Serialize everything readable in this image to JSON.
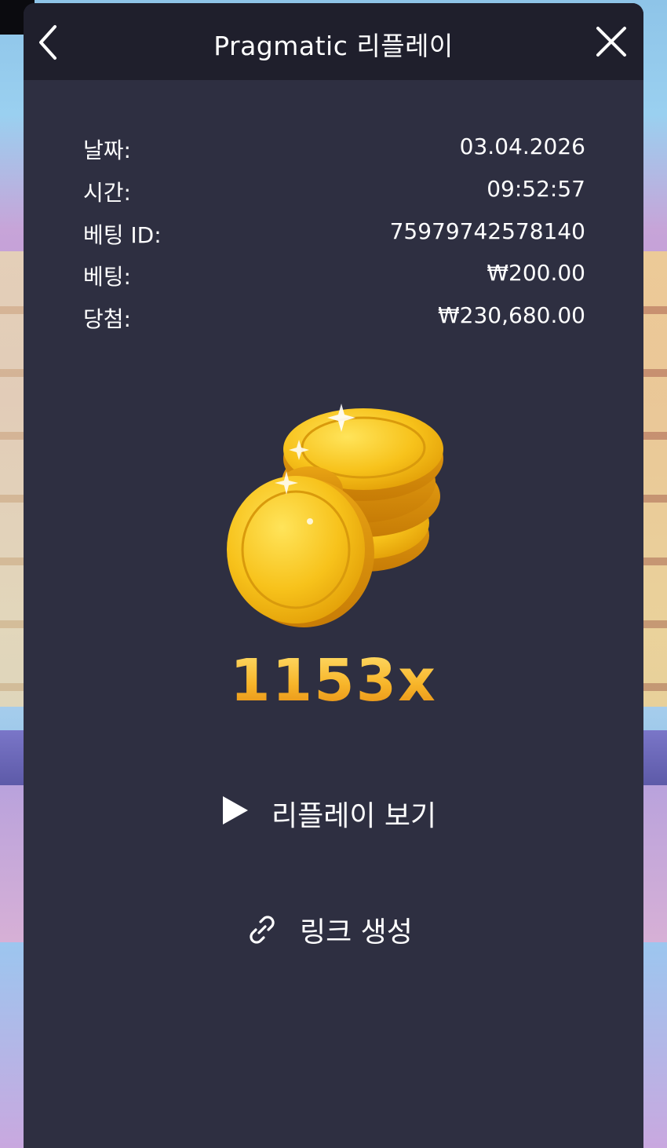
{
  "header": {
    "title": "Pragmatic 리플레이",
    "back_icon": "chevron-left-icon",
    "close_icon": "close-icon"
  },
  "details": [
    {
      "label": "날짜:",
      "value": "03.04.2026"
    },
    {
      "label": "시간:",
      "value": "09:52:57"
    },
    {
      "label": "베팅 ID:",
      "value": "75979742578140"
    },
    {
      "label": "베팅:",
      "value": "₩200.00"
    },
    {
      "label": "당첨:",
      "value": "₩230,680.00"
    }
  ],
  "win": {
    "image": "gold-coins-icon",
    "multiplier": "1153x"
  },
  "actions": {
    "replay_label": "리플레이 보기",
    "replay_icon": "play-icon",
    "link_label": "링크 생성",
    "link_icon": "link-icon"
  },
  "colors": {
    "modal_bg": "#2e2f41",
    "header_bg": "#1f1f2c",
    "multiplier_gold": "#f7b52a",
    "text": "#ffffff"
  }
}
